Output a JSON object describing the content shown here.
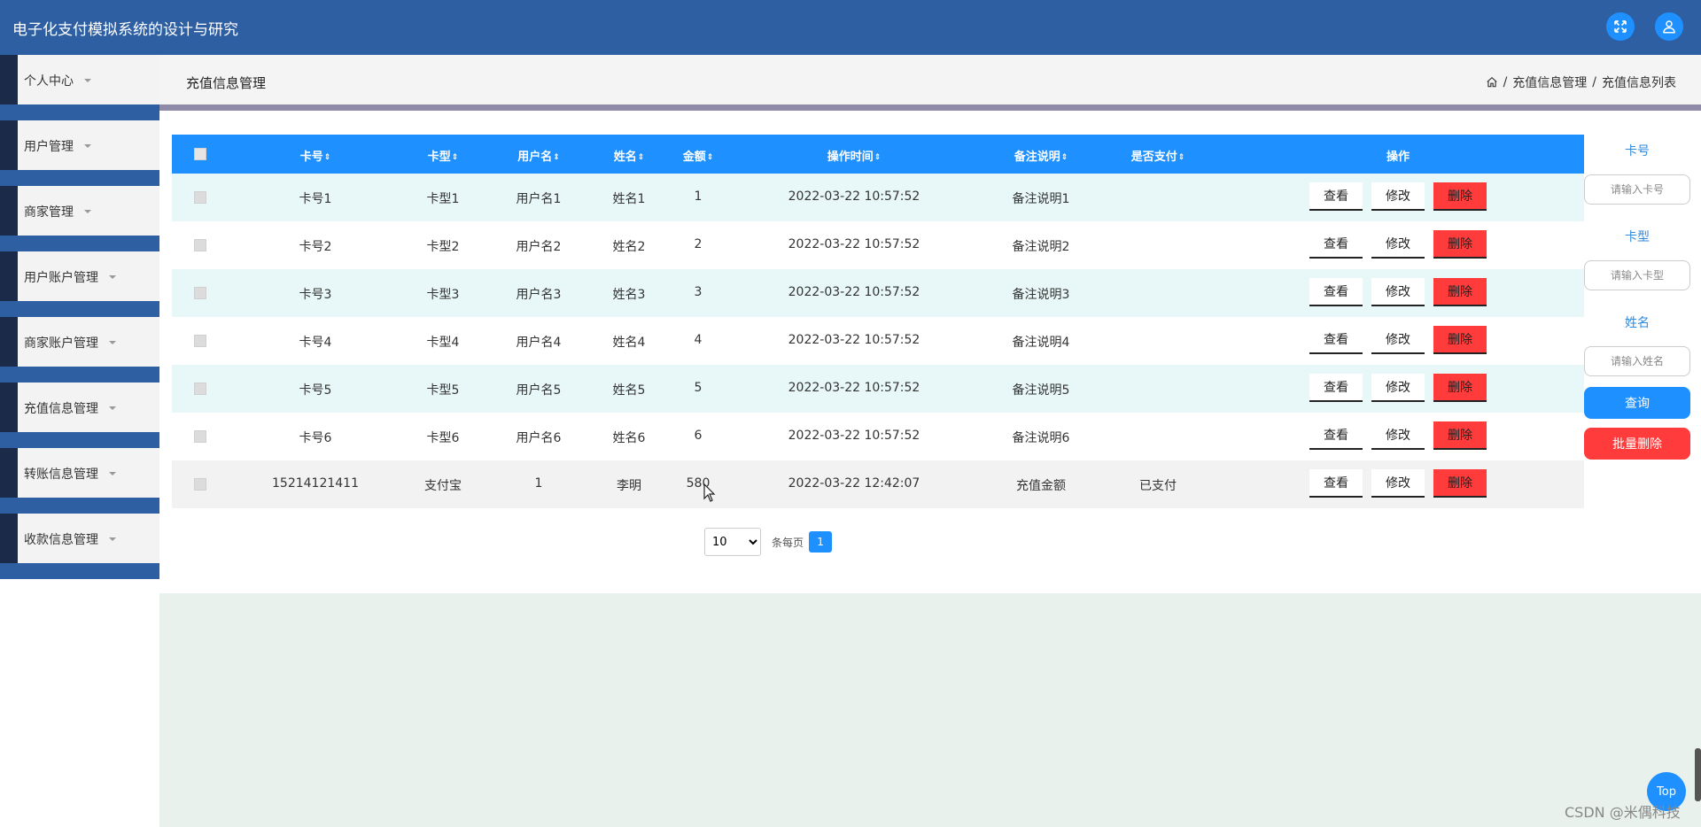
{
  "app": {
    "title": "电子化支付模拟系统的设计与研究"
  },
  "colors": {
    "header": "#2e5fa3",
    "primary": "#1e90ff",
    "danger": "#ff3b3b",
    "link": "#2e8adf"
  },
  "header": {
    "icons": [
      "fullscreen-icon",
      "user-icon"
    ]
  },
  "sidebar": {
    "items": [
      {
        "label": "个人中心"
      },
      {
        "label": "用户管理"
      },
      {
        "label": "商家管理"
      },
      {
        "label": "用户账户管理"
      },
      {
        "label": "商家账户管理"
      },
      {
        "label": "充值信息管理"
      },
      {
        "label": "转账信息管理"
      },
      {
        "label": "收款信息管理"
      }
    ]
  },
  "page": {
    "title": "充值信息管理"
  },
  "breadcrumb": {
    "items": [
      "充值信息管理",
      "充值信息列表"
    ],
    "separator": "/"
  },
  "table": {
    "columns": [
      "卡号",
      "卡型",
      "用户名",
      "姓名",
      "金额",
      "操作时间",
      "备注说明",
      "是否支付",
      "操作"
    ],
    "sort_indicator": "⇕",
    "actions": {
      "view": "查看",
      "edit": "修改",
      "delete": "删除"
    },
    "rows": [
      {
        "card_no": "卡号1",
        "card_type": "卡型1",
        "username": "用户名1",
        "name": "姓名1",
        "amount": "1",
        "time": "2022-03-22 10:57:52",
        "note": "备注说明1",
        "paid": ""
      },
      {
        "card_no": "卡号2",
        "card_type": "卡型2",
        "username": "用户名2",
        "name": "姓名2",
        "amount": "2",
        "time": "2022-03-22 10:57:52",
        "note": "备注说明2",
        "paid": ""
      },
      {
        "card_no": "卡号3",
        "card_type": "卡型3",
        "username": "用户名3",
        "name": "姓名3",
        "amount": "3",
        "time": "2022-03-22 10:57:52",
        "note": "备注说明3",
        "paid": ""
      },
      {
        "card_no": "卡号4",
        "card_type": "卡型4",
        "username": "用户名4",
        "name": "姓名4",
        "amount": "4",
        "time": "2022-03-22 10:57:52",
        "note": "备注说明4",
        "paid": ""
      },
      {
        "card_no": "卡号5",
        "card_type": "卡型5",
        "username": "用户名5",
        "name": "姓名5",
        "amount": "5",
        "time": "2022-03-22 10:57:52",
        "note": "备注说明5",
        "paid": ""
      },
      {
        "card_no": "卡号6",
        "card_type": "卡型6",
        "username": "用户名6",
        "name": "姓名6",
        "amount": "6",
        "time": "2022-03-22 10:57:52",
        "note": "备注说明6",
        "paid": ""
      },
      {
        "card_no": "15214121411",
        "card_type": "支付宝",
        "username": "1",
        "name": "李明",
        "amount": "580",
        "time": "2022-03-22 12:42:07",
        "note": "充值金额",
        "paid": "已支付"
      }
    ]
  },
  "pagination": {
    "page_size": "10",
    "per_page_label": "条每页",
    "current_page": "1"
  },
  "filters": {
    "card_no": {
      "label": "卡号",
      "placeholder": "请输入卡号"
    },
    "card_type": {
      "label": "卡型",
      "placeholder": "请输入卡型"
    },
    "name": {
      "label": "姓名",
      "placeholder": "请输入姓名"
    },
    "query_label": "查询",
    "batch_delete_label": "批量删除"
  },
  "floating": {
    "top_label": "Top"
  },
  "watermark": "CSDN @米偶科技"
}
